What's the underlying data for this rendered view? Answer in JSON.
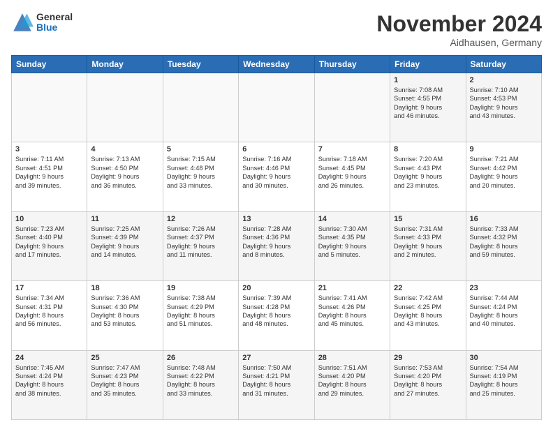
{
  "logo": {
    "general": "General",
    "blue": "Blue"
  },
  "header": {
    "month": "November 2024",
    "location": "Aidhausen, Germany"
  },
  "weekdays": [
    "Sunday",
    "Monday",
    "Tuesday",
    "Wednesday",
    "Thursday",
    "Friday",
    "Saturday"
  ],
  "weeks": [
    [
      {
        "day": "",
        "info": ""
      },
      {
        "day": "",
        "info": ""
      },
      {
        "day": "",
        "info": ""
      },
      {
        "day": "",
        "info": ""
      },
      {
        "day": "",
        "info": ""
      },
      {
        "day": "1",
        "info": "Sunrise: 7:08 AM\nSunset: 4:55 PM\nDaylight: 9 hours\nand 46 minutes."
      },
      {
        "day": "2",
        "info": "Sunrise: 7:10 AM\nSunset: 4:53 PM\nDaylight: 9 hours\nand 43 minutes."
      }
    ],
    [
      {
        "day": "3",
        "info": "Sunrise: 7:11 AM\nSunset: 4:51 PM\nDaylight: 9 hours\nand 39 minutes."
      },
      {
        "day": "4",
        "info": "Sunrise: 7:13 AM\nSunset: 4:50 PM\nDaylight: 9 hours\nand 36 minutes."
      },
      {
        "day": "5",
        "info": "Sunrise: 7:15 AM\nSunset: 4:48 PM\nDaylight: 9 hours\nand 33 minutes."
      },
      {
        "day": "6",
        "info": "Sunrise: 7:16 AM\nSunset: 4:46 PM\nDaylight: 9 hours\nand 30 minutes."
      },
      {
        "day": "7",
        "info": "Sunrise: 7:18 AM\nSunset: 4:45 PM\nDaylight: 9 hours\nand 26 minutes."
      },
      {
        "day": "8",
        "info": "Sunrise: 7:20 AM\nSunset: 4:43 PM\nDaylight: 9 hours\nand 23 minutes."
      },
      {
        "day": "9",
        "info": "Sunrise: 7:21 AM\nSunset: 4:42 PM\nDaylight: 9 hours\nand 20 minutes."
      }
    ],
    [
      {
        "day": "10",
        "info": "Sunrise: 7:23 AM\nSunset: 4:40 PM\nDaylight: 9 hours\nand 17 minutes."
      },
      {
        "day": "11",
        "info": "Sunrise: 7:25 AM\nSunset: 4:39 PM\nDaylight: 9 hours\nand 14 minutes."
      },
      {
        "day": "12",
        "info": "Sunrise: 7:26 AM\nSunset: 4:37 PM\nDaylight: 9 hours\nand 11 minutes."
      },
      {
        "day": "13",
        "info": "Sunrise: 7:28 AM\nSunset: 4:36 PM\nDaylight: 9 hours\nand 8 minutes."
      },
      {
        "day": "14",
        "info": "Sunrise: 7:30 AM\nSunset: 4:35 PM\nDaylight: 9 hours\nand 5 minutes."
      },
      {
        "day": "15",
        "info": "Sunrise: 7:31 AM\nSunset: 4:33 PM\nDaylight: 9 hours\nand 2 minutes."
      },
      {
        "day": "16",
        "info": "Sunrise: 7:33 AM\nSunset: 4:32 PM\nDaylight: 8 hours\nand 59 minutes."
      }
    ],
    [
      {
        "day": "17",
        "info": "Sunrise: 7:34 AM\nSunset: 4:31 PM\nDaylight: 8 hours\nand 56 minutes."
      },
      {
        "day": "18",
        "info": "Sunrise: 7:36 AM\nSunset: 4:30 PM\nDaylight: 8 hours\nand 53 minutes."
      },
      {
        "day": "19",
        "info": "Sunrise: 7:38 AM\nSunset: 4:29 PM\nDaylight: 8 hours\nand 51 minutes."
      },
      {
        "day": "20",
        "info": "Sunrise: 7:39 AM\nSunset: 4:28 PM\nDaylight: 8 hours\nand 48 minutes."
      },
      {
        "day": "21",
        "info": "Sunrise: 7:41 AM\nSunset: 4:26 PM\nDaylight: 8 hours\nand 45 minutes."
      },
      {
        "day": "22",
        "info": "Sunrise: 7:42 AM\nSunset: 4:25 PM\nDaylight: 8 hours\nand 43 minutes."
      },
      {
        "day": "23",
        "info": "Sunrise: 7:44 AM\nSunset: 4:24 PM\nDaylight: 8 hours\nand 40 minutes."
      }
    ],
    [
      {
        "day": "24",
        "info": "Sunrise: 7:45 AM\nSunset: 4:24 PM\nDaylight: 8 hours\nand 38 minutes."
      },
      {
        "day": "25",
        "info": "Sunrise: 7:47 AM\nSunset: 4:23 PM\nDaylight: 8 hours\nand 35 minutes."
      },
      {
        "day": "26",
        "info": "Sunrise: 7:48 AM\nSunset: 4:22 PM\nDaylight: 8 hours\nand 33 minutes."
      },
      {
        "day": "27",
        "info": "Sunrise: 7:50 AM\nSunset: 4:21 PM\nDaylight: 8 hours\nand 31 minutes."
      },
      {
        "day": "28",
        "info": "Sunrise: 7:51 AM\nSunset: 4:20 PM\nDaylight: 8 hours\nand 29 minutes."
      },
      {
        "day": "29",
        "info": "Sunrise: 7:53 AM\nSunset: 4:20 PM\nDaylight: 8 hours\nand 27 minutes."
      },
      {
        "day": "30",
        "info": "Sunrise: 7:54 AM\nSunset: 4:19 PM\nDaylight: 8 hours\nand 25 minutes."
      }
    ]
  ]
}
